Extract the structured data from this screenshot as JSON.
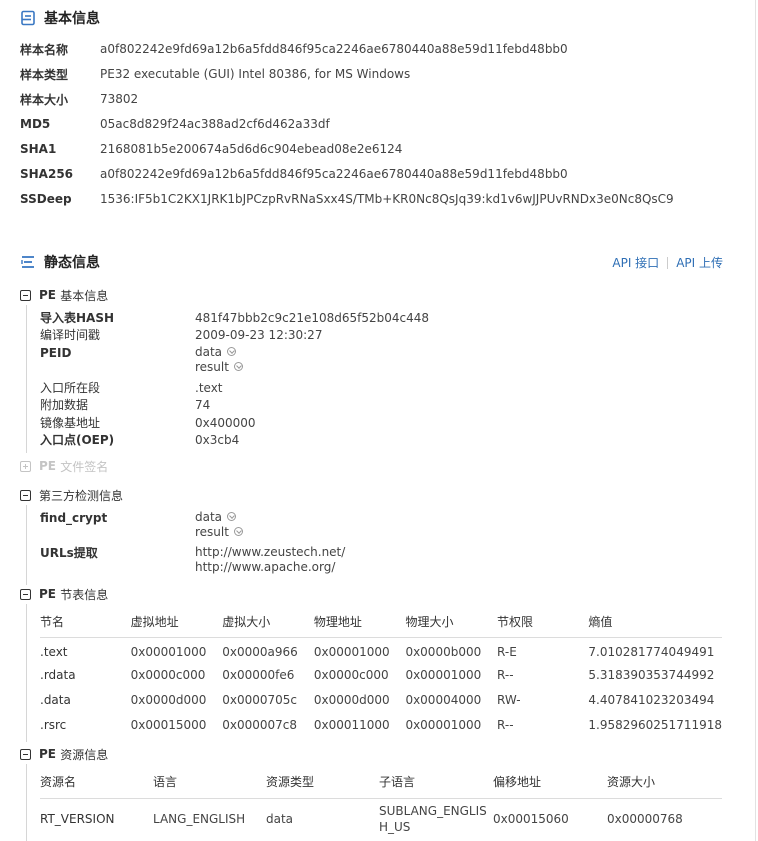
{
  "basic": {
    "title": "基本信息",
    "icon": "document-icon",
    "rows": [
      {
        "label": "样本名称",
        "value": "a0f802242e9fd69a12b6a5fdd846f95ca2246ae6780440a88e59d11febd48bb0"
      },
      {
        "label": "样本类型",
        "value": "PE32 executable (GUI) Intel 80386, for MS Windows"
      },
      {
        "label": "样本大小",
        "value": "73802"
      },
      {
        "label": "MD5",
        "value": "05ac8d829f24ac388ad2cf6d462a33df"
      },
      {
        "label": "SHA1",
        "value": "2168081b5e200674a5d6d6c904ebead08e2e6124"
      },
      {
        "label": "SHA256",
        "value": "a0f802242e9fd69a12b6a5fdd846f95ca2246ae6780440a88e59d11febd48bb0"
      },
      {
        "label": "SSDeep",
        "value": "1536:IF5b1C2KX1JRK1bJPCzpRvRNaSxx4S/TMb+KR0Nc8QsJq39:kd1v6wJJPUvRNDx3e0Nc8QsC9"
      }
    ]
  },
  "static": {
    "title": "静态信息",
    "icon": "list-icon",
    "api_links": [
      "API 接口",
      "API 上传"
    ],
    "link_color": "#2f6fb5",
    "pe_basic": {
      "title_prefix": "PE",
      "title": "基本信息",
      "rows": [
        {
          "label": "导入表HASH",
          "value": "481f47bbb2c9c21e108d65f52b04c448"
        },
        {
          "label": "编译时间戳",
          "value": "2009-09-23 12:30:27"
        },
        {
          "label": "PEID",
          "value_lines": [
            "data",
            "result"
          ]
        },
        {
          "label": "入口所在段",
          "value": ".text"
        },
        {
          "label": "附加数据",
          "value": "74"
        },
        {
          "label": "镜像基地址",
          "value": "0x400000"
        },
        {
          "label": "入口点(OEP)",
          "value": "0x3cb4"
        }
      ]
    },
    "pe_signature": {
      "title_prefix": "PE",
      "title": "文件签名"
    },
    "third_party": {
      "title": "第三方检测信息",
      "rows": [
        {
          "label": "find_crypt",
          "value_lines": [
            "data",
            "result"
          ]
        },
        {
          "label": "URLs提取",
          "value_lines": [
            "http://www.zeustech.net/",
            "http://www.apache.org/"
          ]
        }
      ]
    },
    "pe_sections": {
      "title_prefix": "PE",
      "title": "节表信息",
      "columns": [
        "节名",
        "虚拟地址",
        "虚拟大小",
        "物理地址",
        "物理大小",
        "节权限",
        "熵值"
      ],
      "rows": [
        [
          ".text",
          "0x00001000",
          "0x0000a966",
          "0x00001000",
          "0x0000b000",
          "R-E",
          "7.010281774049491"
        ],
        [
          ".rdata",
          "0x0000c000",
          "0x00000fe6",
          "0x0000c000",
          "0x00001000",
          "R--",
          "5.318390353744992"
        ],
        [
          ".data",
          "0x0000d000",
          "0x0000705c",
          "0x0000d000",
          "0x00004000",
          "RW-",
          "4.407841023203494"
        ],
        [
          ".rsrc",
          "0x00015000",
          "0x000007c8",
          "0x00011000",
          "0x00001000",
          "R--",
          "1.9582960251711918"
        ]
      ]
    },
    "pe_resources": {
      "title_prefix": "PE",
      "title": "资源信息",
      "columns": [
        "资源名",
        "语言",
        "资源类型",
        "子语言",
        "偏移地址",
        "资源大小"
      ],
      "rows": [
        [
          "RT_VERSION",
          "LANG_ENGLISH",
          "data",
          "SUBLANG_ENGLISH_US",
          "0x00015060",
          "0x00000768"
        ]
      ]
    }
  }
}
